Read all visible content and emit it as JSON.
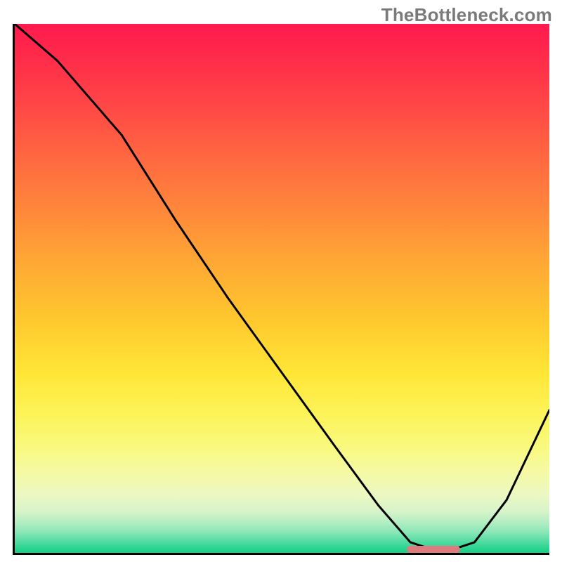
{
  "watermark": "TheBottleneck.com",
  "colors": {
    "gradient_top": "#ff1a4d",
    "gradient_bottom": "#12cf86",
    "curve": "#000000",
    "marker": "#dd7b7d",
    "axes": "#000000"
  },
  "chart_data": {
    "type": "line",
    "title": "",
    "xlabel": "",
    "ylabel": "",
    "xlim": [
      0,
      100
    ],
    "ylim": [
      0,
      100
    ],
    "series": [
      {
        "name": "bottleneck-curve",
        "x": [
          0,
          8,
          20,
          30,
          40,
          50,
          60,
          68,
          74,
          80,
          86,
          92,
          100
        ],
        "values": [
          100,
          93,
          79,
          63,
          48,
          34,
          20,
          9,
          2,
          0,
          2,
          10,
          27
        ]
      }
    ],
    "minimum_marker": {
      "x_start": 73,
      "x_end": 83,
      "y": 0
    }
  }
}
